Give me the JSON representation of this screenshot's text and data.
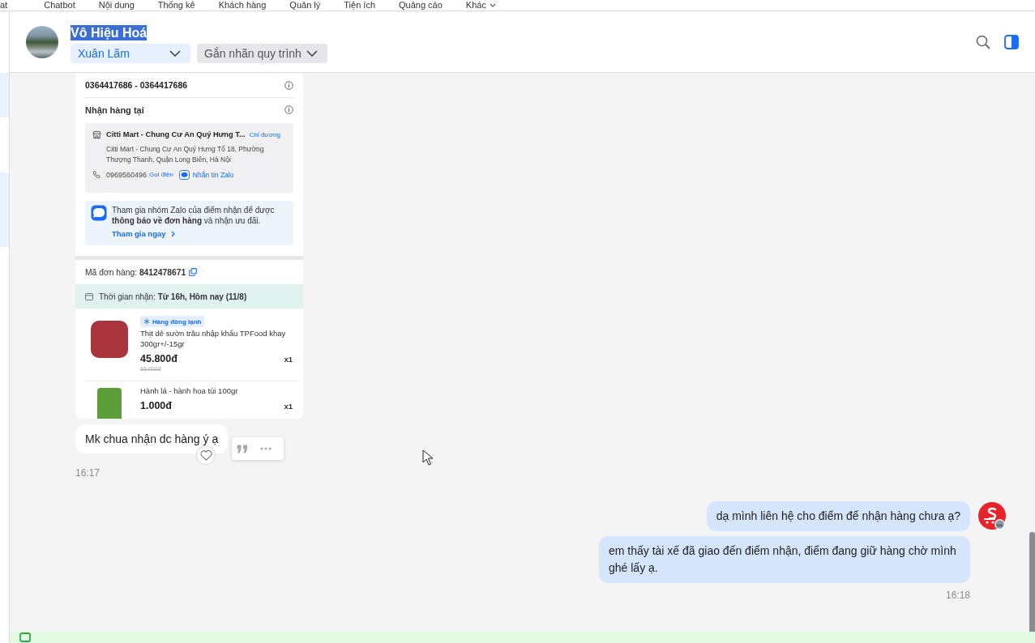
{
  "top_nav": {
    "items": [
      {
        "label": "at",
        "kind": "link"
      },
      {
        "label": "Chatbot",
        "kind": "link"
      },
      {
        "label": "Nội dung",
        "kind": "link"
      },
      {
        "label": "Thống kê",
        "kind": "link"
      },
      {
        "label": "Khách hàng",
        "kind": "link"
      },
      {
        "label": "Quản lý",
        "kind": "link"
      },
      {
        "label": "Tiện ích",
        "kind": "link"
      },
      {
        "label": "Quảng cáo",
        "kind": "link"
      },
      {
        "label": "Khác",
        "kind": "menu"
      }
    ]
  },
  "conversation_header": {
    "name": "Vô Hiệu Hoá",
    "name_selected": true,
    "assignee": "Xuân Lãm",
    "label_picker": "Gắn nhãn quy trình"
  },
  "message_groups": [
    {
      "outgoing": false,
      "messages": [
        {
          "kind": "screenshot",
          "order": {
            "phones": "0364417686 - 0364417686",
            "pickup_heading": "Nhận hàng tại",
            "store": {
              "name": "Citti Mart - Chung Cư An Quý Hưng T...",
              "directions_link": "Chỉ đường",
              "address": "Citti Mart - Chung Cư An Quý Hưng Tổ 18, Phường Thượng Thanh, Quận Long Biên, Hà Nội",
              "phone": "0969560496",
              "call_link": "Gọi điện",
              "chat_link": "Nhắn tin Zalo"
            },
            "promo": {
              "text": "Tham gia nhóm Zalo của điểm nhận để được **thông báo về đơn hàng** và nhận ưu đãi.",
              "link": "Tham gia ngay"
            },
            "order_id": "Mã đơn hàng: **8412478671**",
            "pickup_time": "Thời gian nhận: **Từ 16h, Hôm nay (11/8)**",
            "items": [
              {
                "tag": "Hàng đông lạnh",
                "name": "Thịt dẻ sườn trâu nhập khẩu TPFood khay 300gr+/-15gr",
                "price": "45.800đ",
                "old_price": "65.000đ",
                "quantity": "x1"
              },
              {
                "name": "Hành lá - hành hoa túi 100gr",
                "price": "1.000đ",
                "quantity": "x1"
              }
            ]
          }
        },
        {
          "kind": "text",
          "text": "Mk chua nhận dc hàng ý ạ",
          "hovered": true
        }
      ],
      "time": "16:17"
    },
    {
      "outgoing": true,
      "messages": [
        {
          "kind": "text",
          "text": "dạ mình liên hệ cho điểm để nhận hàng chưa ạ?",
          "hovered": false
        },
        {
          "kind": "text",
          "text": "em thấy tài xế đã giao đến điểm nhận, điểm đang giữ hàng chờ mình ghé lấy ạ.",
          "hovered": false
        }
      ],
      "time": "16:18"
    }
  ],
  "notice_bar": {
    "success": true
  }
}
